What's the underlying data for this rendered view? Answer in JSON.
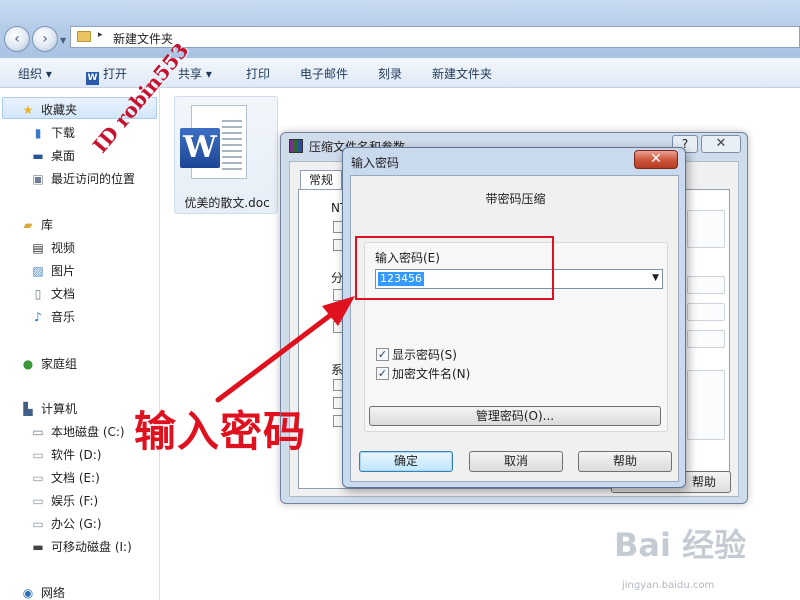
{
  "explorer": {
    "address_arrow": "▸",
    "address": "新建文件夹",
    "back_icon": "back-arrow-icon",
    "forward_icon": "forward-arrow-icon"
  },
  "toolbar": {
    "organize": "组织 ▾",
    "open": "打开",
    "share": "共享 ▾",
    "print": "打印",
    "email": "电子邮件",
    "burn": "刻录",
    "new_folder": "新建文件夹",
    "word_letter": "W"
  },
  "sidebar": {
    "favorites": "收藏夹",
    "downloads": "下载",
    "desktop": "桌面",
    "recent": "最近访问的位置",
    "libraries": "库",
    "videos": "视频",
    "pictures": "图片",
    "documents": "文档",
    "music": "音乐",
    "homegroup": "家庭组",
    "computer": "计算机",
    "drive_c": "本地磁盘 (C:)",
    "drive_d": "软件 (D:)",
    "drive_e": "文档 (E:)",
    "drive_f": "娱乐 (F:)",
    "drive_g": "办公 (G:)",
    "drive_i": "可移动磁盘 (I:)",
    "network": "网络"
  },
  "file": {
    "name": "优美的散文.doc",
    "badge": "W"
  },
  "rar_dialog": {
    "title": "压缩文件名和参数",
    "help_glyph": "?",
    "close_glyph": "✕",
    "tab_general": "常规",
    "group_ntfs": "NTF",
    "group_split": "分卷",
    "group_system": "系统",
    "help_button": "帮助"
  },
  "password_dialog": {
    "title": "输入密码",
    "close_glyph": "✕",
    "heading": "带密码压缩",
    "label": "输入密码(E)",
    "value": "123456",
    "combo_arrow": "▼",
    "show_password": "显示密码(S)",
    "show_password_checked": true,
    "encrypt_names": "加密文件名(N)",
    "encrypt_names_checked": true,
    "check_glyph": "✓",
    "manage": "管理密码(O)...",
    "ok": "确定",
    "cancel": "取消",
    "help": "帮助"
  },
  "annotation": {
    "text": "输入密码",
    "color": "#e0111e"
  },
  "watermarks": {
    "id": "ID robin553",
    "baidu": "Bai 经验",
    "baidu_sub": "jingyan.baidu.com"
  }
}
